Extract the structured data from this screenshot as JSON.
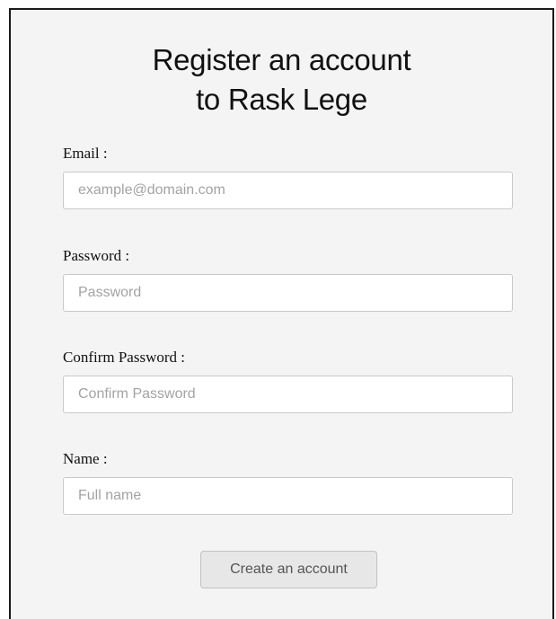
{
  "form": {
    "title_line1": "Register an account",
    "title_line2": "to Rask Lege",
    "fields": [
      {
        "label": "Email :",
        "placeholder": "example@domain.com",
        "value": ""
      },
      {
        "label": "Password :",
        "placeholder": "Password",
        "value": ""
      },
      {
        "label": "Confirm Password :",
        "placeholder": "Confirm Password",
        "value": ""
      },
      {
        "label": "Name :",
        "placeholder": "Full name",
        "value": ""
      }
    ],
    "submit_label": "Create an account"
  }
}
